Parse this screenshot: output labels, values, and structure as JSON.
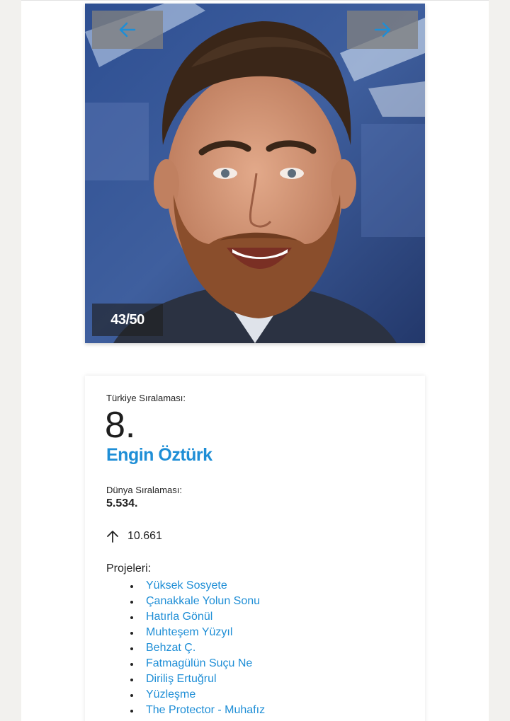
{
  "slider": {
    "counter": "43/50",
    "prev_icon": "arrow-left-icon",
    "next_icon": "arrow-right-icon"
  },
  "person": {
    "turkey_label": "Türkiye Sıralaması:",
    "turkey_rank": "8.",
    "name": "Engin Öztürk",
    "world_label": "Dünya Sıralaması:",
    "world_rank": "5.534.",
    "trend_icon": "arrow-up-icon",
    "trend_value": "10.661",
    "projects_label": "Projeleri:",
    "projects": [
      "Yüksek Sosyete",
      "Çanakkale Yolun Sonu",
      "Hatırla Gönül",
      "Muhteşem Yüzyıl",
      "Behzat Ç.",
      "Fatmagülün Suçu Ne",
      "Diriliş Ertuğrul",
      "Yüzleşme",
      "The Protector - Muhafız"
    ]
  },
  "colors": {
    "link": "#1e8ed6",
    "arrow": "#1e8ed6",
    "nav_button_bg": "#808080",
    "page_bg": "#f2f1ee"
  }
}
